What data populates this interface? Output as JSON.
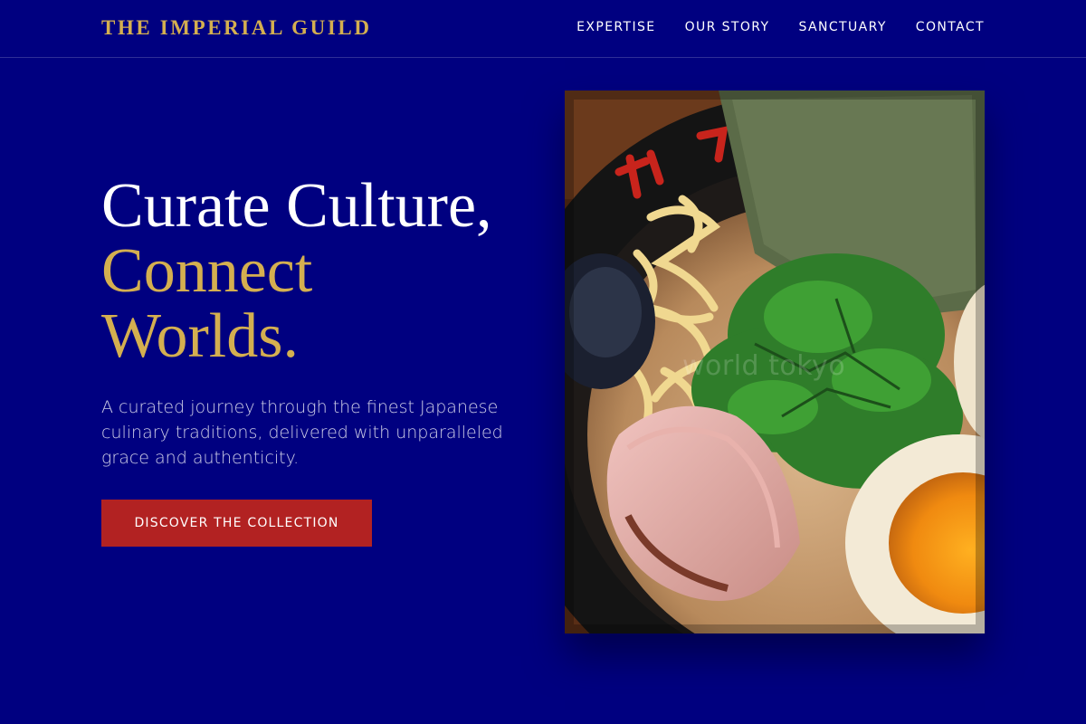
{
  "header": {
    "brand": "THE IMPERIAL GUILD",
    "nav": [
      "EXPERTISE",
      "OUR STORY",
      "SANCTUARY",
      "CONTACT"
    ]
  },
  "hero": {
    "title_line1": "Curate Culture,",
    "title_line2": "Connect",
    "title_line3": "Worlds.",
    "description": "A curated journey through the finest Japanese culinary traditions, delivered with unparalleled grace and authenticity.",
    "cta_label": "DISCOVER THE COLLECTION",
    "image_watermark": "world tokyo"
  },
  "colors": {
    "background": "#000080",
    "accent_gold": "#d4af50",
    "cta_red": "#b22222",
    "text": "#ffffff"
  }
}
